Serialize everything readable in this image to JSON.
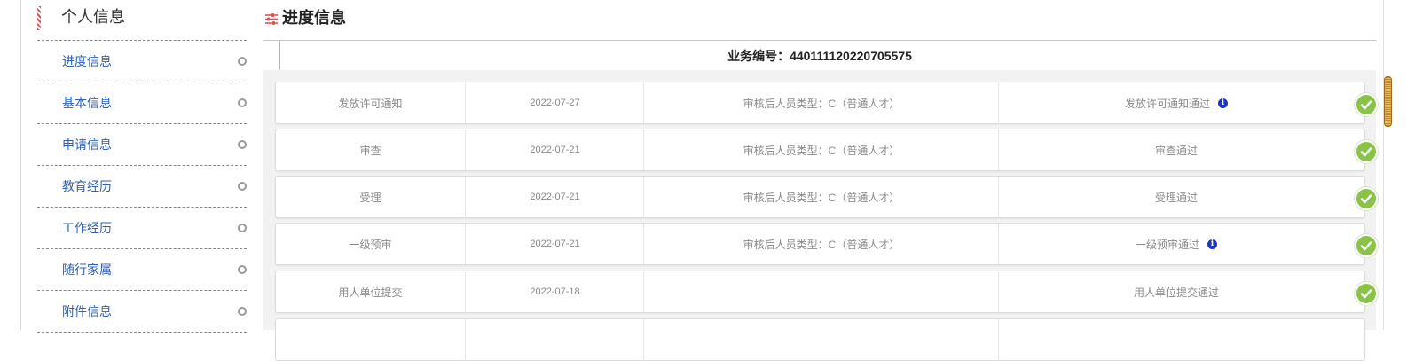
{
  "sidebar": {
    "title": "个人信息",
    "items": [
      {
        "label": "进度信息"
      },
      {
        "label": "基本信息"
      },
      {
        "label": "申请信息"
      },
      {
        "label": "教育经历"
      },
      {
        "label": "工作经历"
      },
      {
        "label": "随行家属"
      },
      {
        "label": "附件信息"
      }
    ]
  },
  "main": {
    "title": "进度信息",
    "business_number": "业务编号：440111120220705575",
    "rows": [
      {
        "step": "发放许可通知",
        "date": "2022-07-27",
        "note": "审核后人员类型：C（普通人才）",
        "result": "发放许可通知通过",
        "has_info": true
      },
      {
        "step": "审查",
        "date": "2022-07-21",
        "note": "审核后人员类型：C（普通人才）",
        "result": "审查通过",
        "has_info": false
      },
      {
        "step": "受理",
        "date": "2022-07-21",
        "note": "审核后人员类型：C（普通人才）",
        "result": "受理通过",
        "has_info": false
      },
      {
        "step": "一级预审",
        "date": "2022-07-21",
        "note": "审核后人员类型：C（普通人才）",
        "result": "一级预审通过",
        "has_info": true
      },
      {
        "step": "用人单位提交",
        "date": "2022-07-18",
        "note": "",
        "result": "用人单位提交通过",
        "has_info": false
      }
    ]
  },
  "icons": {
    "title_icon": "sliders-icon",
    "info_icon": "info-icon",
    "status_icon": "check-circle-icon",
    "info_glyph": "i"
  },
  "colors": {
    "link_blue": "#2d5fb5",
    "success_green": "#8bc34a",
    "info_blue": "#1a35c7",
    "accent_red": "#e25050"
  }
}
